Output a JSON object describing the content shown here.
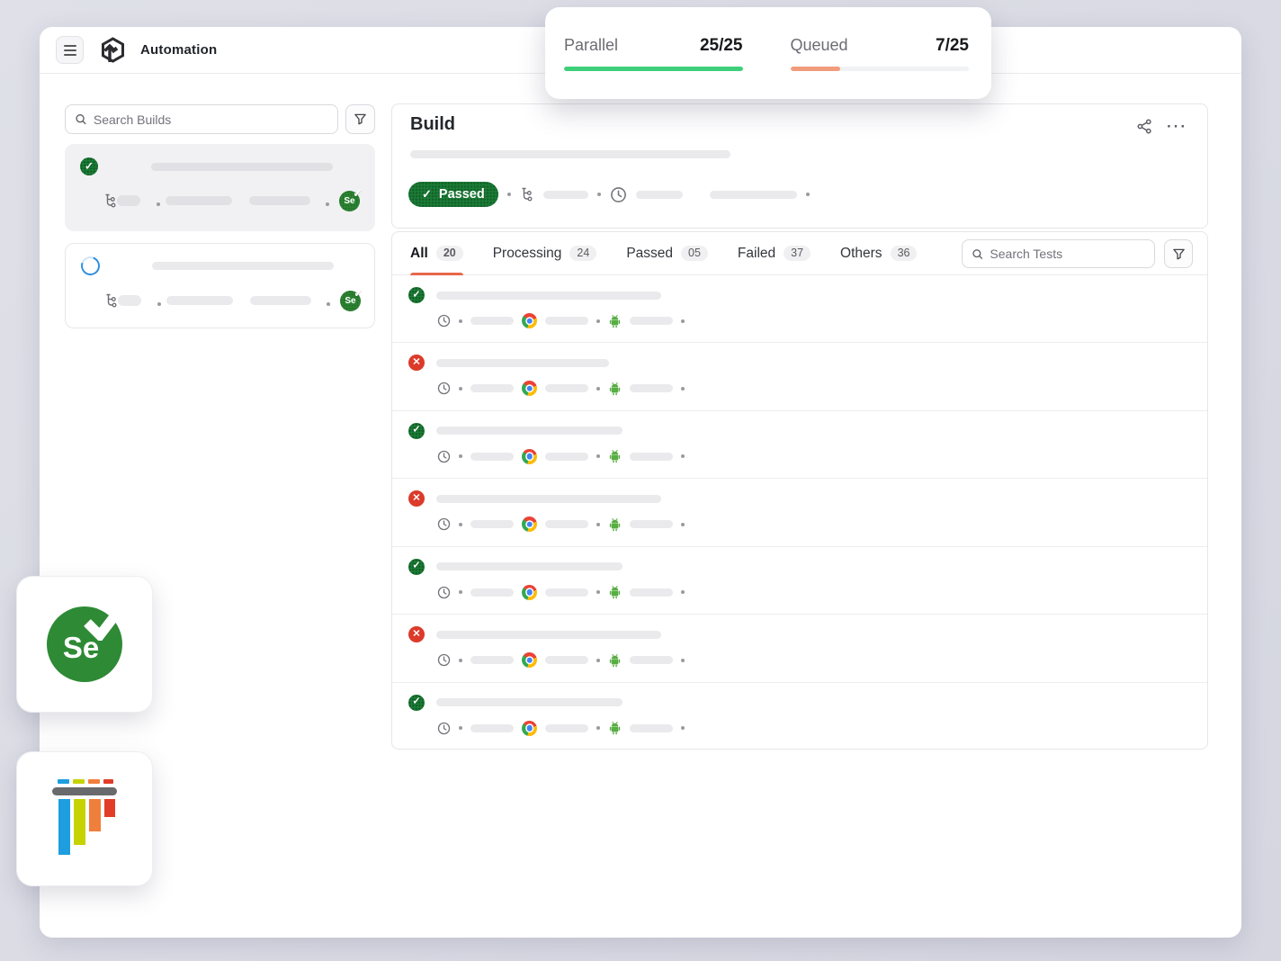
{
  "header": {
    "title": "Automation"
  },
  "concurrency": {
    "parallel": {
      "label": "Parallel",
      "value": "25/25",
      "percent": 100,
      "color": "#3ecf7a"
    },
    "queued": {
      "label": "Queued",
      "value": "7/25",
      "percent": 28,
      "color": "#f19c7c"
    }
  },
  "sidebar": {
    "search": {
      "placeholder": "Search Builds"
    },
    "builds": [
      {
        "status": "passed",
        "framework": "Se",
        "selected": true
      },
      {
        "status": "running",
        "framework": "Se",
        "selected": false
      }
    ]
  },
  "build_panel": {
    "title": "Build",
    "status_badge": "Passed"
  },
  "tests_panel": {
    "search": {
      "placeholder": "Search Tests"
    },
    "tabs": [
      {
        "label": "All",
        "count": "20",
        "active": true
      },
      {
        "label": "Processing",
        "count": "24",
        "active": false
      },
      {
        "label": "Passed",
        "count": "05",
        "active": false
      },
      {
        "label": "Failed",
        "count": "37",
        "active": false
      },
      {
        "label": "Others",
        "count": "36",
        "active": false
      }
    ],
    "tests": [
      {
        "status": "passed",
        "title_width": 250
      },
      {
        "status": "failed",
        "title_width": 192
      },
      {
        "status": "passed",
        "title_width": 207
      },
      {
        "status": "failed",
        "title_width": 250
      },
      {
        "status": "passed",
        "title_width": 207
      },
      {
        "status": "failed",
        "title_width": 250
      },
      {
        "status": "passed",
        "title_width": 207
      }
    ]
  },
  "floating_logos": {
    "selenium": {
      "label": "Se"
    },
    "pytest": {
      "name": "pytest-logo",
      "colors": {
        "blue": "#1e9ede",
        "yellow": "#c6d300",
        "orange": "#f07f3c",
        "red": "#e23d28",
        "gray": "#696a6b"
      }
    }
  },
  "icons": {
    "check": "✓",
    "cross": "✕",
    "ellipsis": "···"
  }
}
